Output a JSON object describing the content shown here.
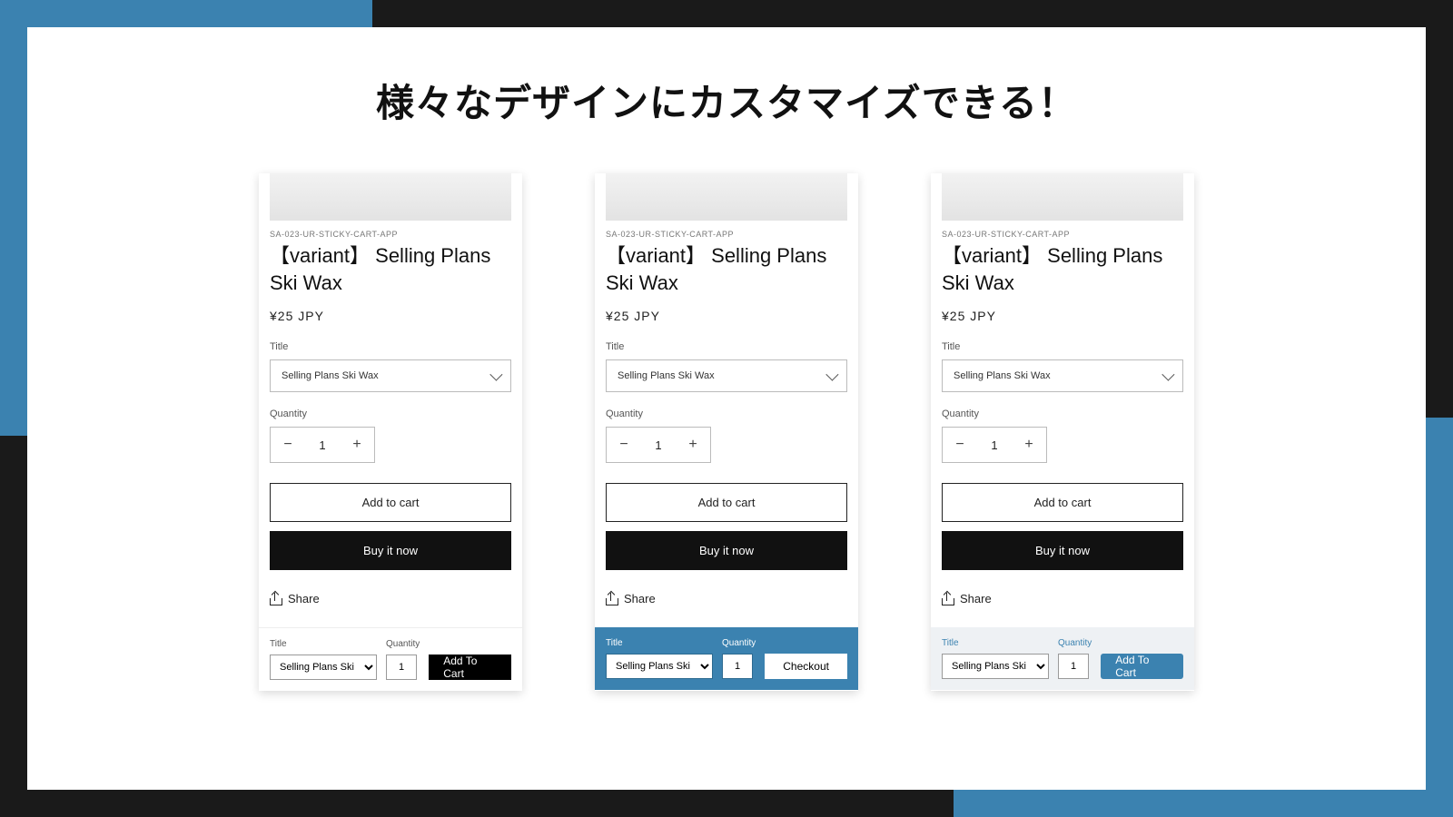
{
  "headline": "様々なデザインにカスタマイズできる！",
  "cards": [
    {
      "vendor": "SA-023-UR-STICKY-CART-APP",
      "title": "【variant】 Selling Plans Ski Wax",
      "price": "¥25 JPY",
      "variant_label": "Title",
      "variant_value": "Selling Plans Ski Wax",
      "qty_label": "Quantity",
      "qty_value": "1",
      "add_label": "Add to cart",
      "buy_label": "Buy it now",
      "share_label": "Share",
      "sticky": {
        "variant_label": "Title",
        "variant_value": "Selling Plans Ski",
        "qty_label": "Quantity",
        "qty_value": "1",
        "cta": "Add To Cart"
      }
    },
    {
      "vendor": "SA-023-UR-STICKY-CART-APP",
      "title": "【variant】 Selling Plans Ski Wax",
      "price": "¥25 JPY",
      "variant_label": "Title",
      "variant_value": "Selling Plans Ski Wax",
      "qty_label": "Quantity",
      "qty_value": "1",
      "add_label": "Add to cart",
      "buy_label": "Buy it now",
      "share_label": "Share",
      "sticky": {
        "variant_label": "Title",
        "variant_value": "Selling Plans Ski",
        "qty_label": "Quantity",
        "qty_value": "1",
        "cta": "Checkout"
      }
    },
    {
      "vendor": "SA-023-UR-STICKY-CART-APP",
      "title": "【variant】 Selling Plans Ski Wax",
      "price": "¥25 JPY",
      "variant_label": "Title",
      "variant_value": "Selling Plans Ski Wax",
      "qty_label": "Quantity",
      "qty_value": "1",
      "add_label": "Add to cart",
      "buy_label": "Buy it now",
      "share_label": "Share",
      "sticky": {
        "variant_label": "Title",
        "variant_value": "Selling Plans Ski",
        "qty_label": "Quantity",
        "qty_value": "1",
        "cta": "Add To Cart"
      }
    }
  ]
}
